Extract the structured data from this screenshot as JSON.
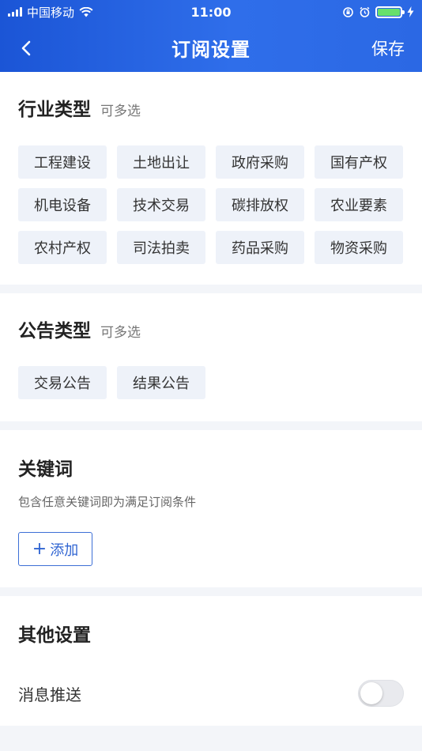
{
  "status_bar": {
    "carrier": "中国移动",
    "time": "11:00"
  },
  "nav": {
    "title": "订阅设置",
    "save_label": "保存"
  },
  "industry": {
    "title": "行业类型",
    "hint": "可多选",
    "tags": [
      "工程建设",
      "土地出让",
      "政府采购",
      "国有产权",
      "机电设备",
      "技术交易",
      "碳排放权",
      "农业要素",
      "农村产权",
      "司法拍卖",
      "药品采购",
      "物资采购"
    ]
  },
  "notice": {
    "title": "公告类型",
    "hint": "可多选",
    "tags": [
      "交易公告",
      "结果公告"
    ]
  },
  "keyword": {
    "title": "关键词",
    "description": "包含任意关键词即为满足订阅条件",
    "add_label": "添加"
  },
  "other": {
    "title": "其他设置",
    "push_label": "消息推送",
    "push_enabled": false
  },
  "colors": {
    "header": "#2b68e4",
    "accent": "#2f64d2",
    "tag_bg": "#eef2f9"
  }
}
